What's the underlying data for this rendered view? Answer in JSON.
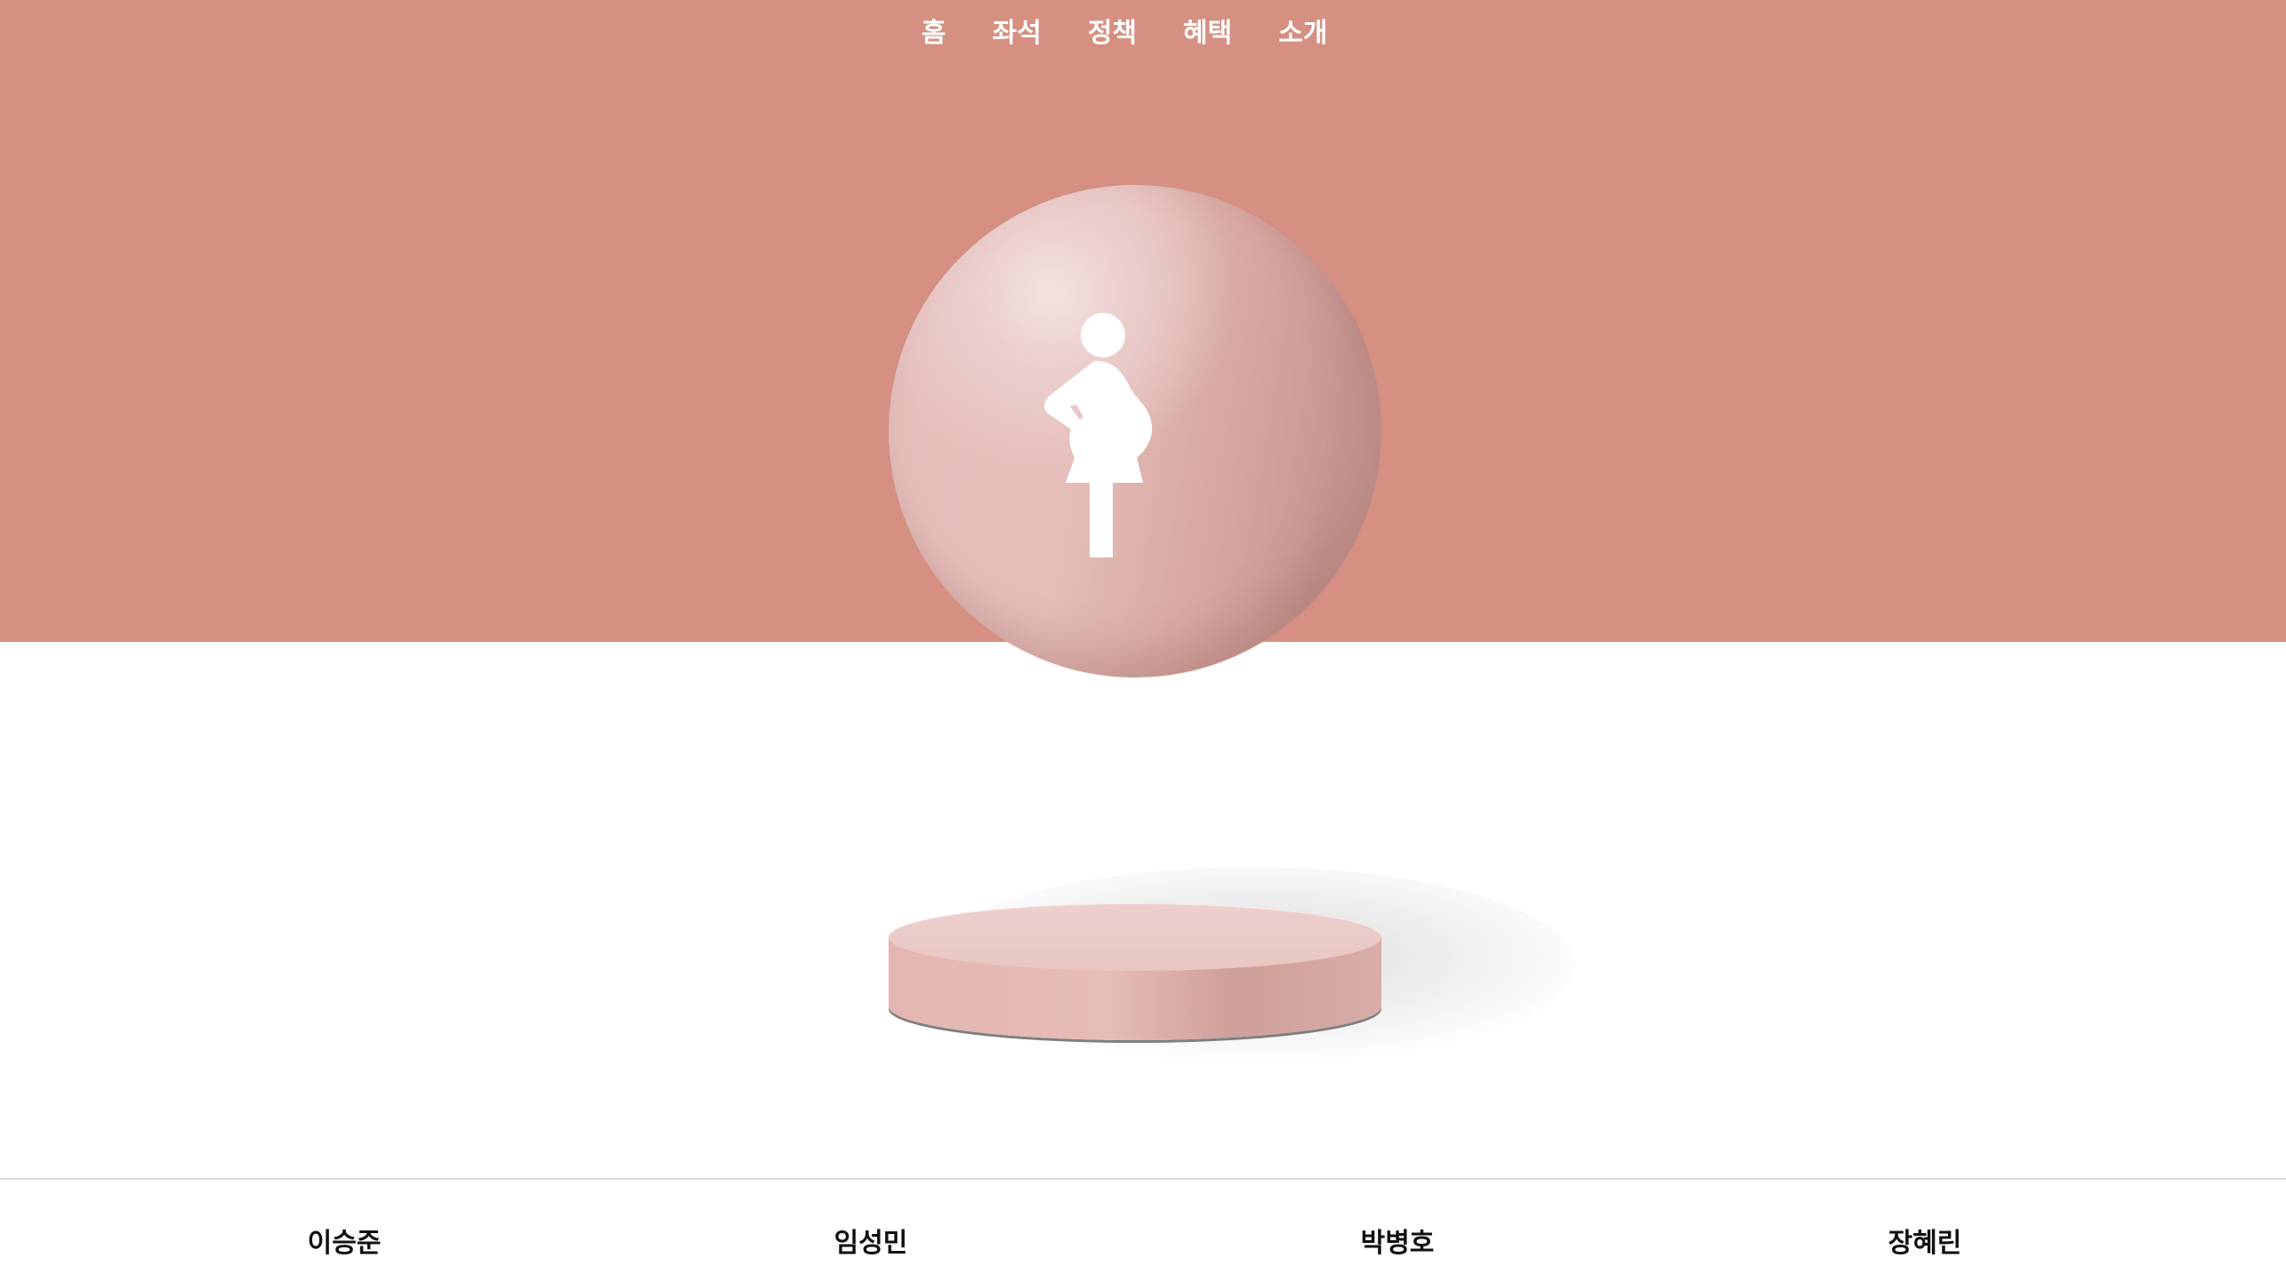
{
  "nav": {
    "items": [
      {
        "label": "홈"
      },
      {
        "label": "좌석"
      },
      {
        "label": "정책"
      },
      {
        "label": "혜택"
      },
      {
        "label": "소개"
      }
    ]
  },
  "hero": {
    "icon": "pregnant-woman-icon",
    "colors": {
      "background": "#d59081",
      "sphere": "#e6bfbb",
      "podium": "#e3b6b1"
    }
  },
  "footer": {
    "names": [
      "이승준",
      "임성민",
      "박병호",
      "장혜린"
    ]
  }
}
